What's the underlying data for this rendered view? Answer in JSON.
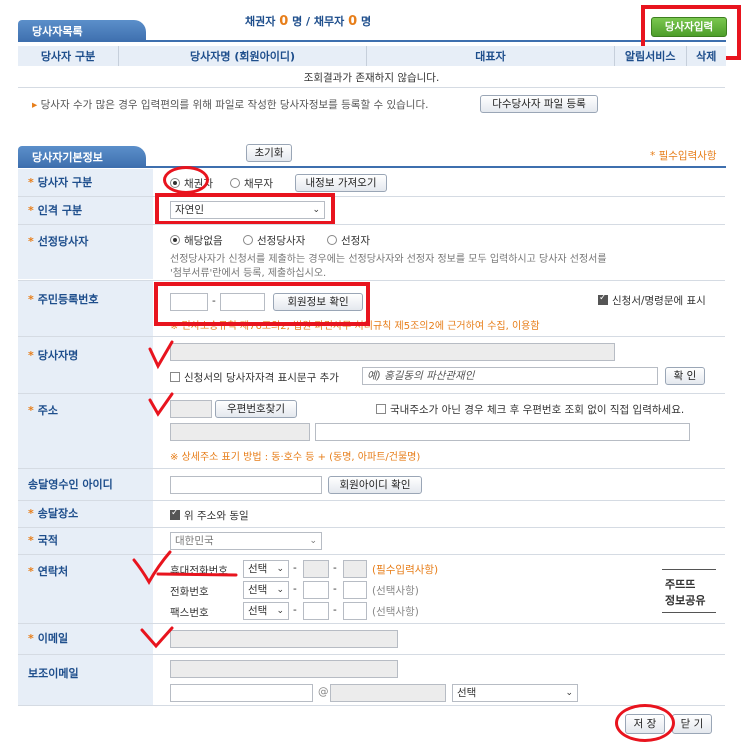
{
  "list_section": {
    "tab_title": "당사자목록",
    "count_prefix_creditor": "채권자",
    "creditor_count": "0",
    "count_unit1": "명 / 채무자",
    "debtor_count": "0",
    "count_unit2": "명",
    "add_button": "당사자입력",
    "columns": [
      "당사자 구분",
      "당사자명 (회원아이디)",
      "대표자",
      "알림서비스",
      "삭제"
    ],
    "empty_message": "조회결과가 존재하지 않습니다.",
    "bulk_info": "당사자 수가 많은 경우 입력편의를 위해 파일로 작성한 당사자정보를 등록할 수 있습니다.",
    "bulk_button": "다수당사자 파일 등록"
  },
  "info_section": {
    "tab_title": "당사자기본정보",
    "reset_button": "초기화",
    "required_note": "* 필수입력사항"
  },
  "fields": {
    "party_type": {
      "label": "당사자 구분",
      "opt1": "채권자",
      "opt2": "채무자",
      "load_button": "내정보 가져오기"
    },
    "person_type": {
      "label": "인격 구분",
      "value": "자연인"
    },
    "selected_party": {
      "label": "선정당사자",
      "opt1": "해당없음",
      "opt2": "선정당사자",
      "opt3": "선정자",
      "desc1": "선정당사자가 신청서를 제출하는 경우에는 선정당사자와 선정자 정보를 모두 입력하시고 당사자 선정서를",
      "desc2": "'첨부서류'란에서 등록, 제출하십시오."
    },
    "rrn": {
      "label": "주민등록번호",
      "confirm_button": "회원정보 확인",
      "display_check": "신청서/명령문에 표시",
      "legal_note": "※ 민사소송규칙 제76조의2, 법원 파견사무 처리규칙 제5조의2에 근거하여 수집, 이용함"
    },
    "party_name": {
      "label": "당사자명",
      "qualify_check": "신청서의 당사자자격 표시문구 추가",
      "qualify_placeholder": "예) 홍길동의 파산관재인",
      "confirm_button": "확 인"
    },
    "address": {
      "label": "주소",
      "zip_button": "우편번호찾기",
      "foreign_check": "국내주소가 아닌 경우 체크 후 우편번호 조회 없이 직접 입력하세요.",
      "detail_note": "※ 상세주소 표기 방법 : 동·호수 등 + (동명, 아파트/건물명)"
    },
    "receiver_id": {
      "label": "송달영수인 아이디",
      "confirm_button": "회원아이디 확인"
    },
    "delivery_place": {
      "label": "송달장소",
      "same_check": "위 주소와 동일"
    },
    "nationality": {
      "label": "국적",
      "value": "대한민국"
    },
    "contact": {
      "label": "연락처",
      "mobile_label": "휴대전화번호",
      "phone_label": "전화번호",
      "fax_label": "팩스번호",
      "select_label": "선택",
      "mobile_note": "(필수입력사항)",
      "optional_note": "(선택사항)",
      "share_line1": "주뜨뜨",
      "share_line2": "정보공유"
    },
    "email": {
      "label": "이메일"
    },
    "sub_email": {
      "label": "보조이메일",
      "at": "@",
      "domain_select": "선택"
    }
  },
  "footer": {
    "save_button": "저 장",
    "close_button": "닫 기"
  }
}
